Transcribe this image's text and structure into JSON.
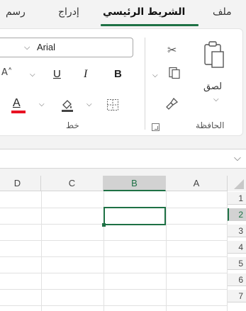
{
  "tabs": {
    "draw": "رسم",
    "insert": "إدراج",
    "home": "الشريط الرئيسي",
    "file": "ملف"
  },
  "ribbon": {
    "font_name": "Arial",
    "bold": "B",
    "italic": "I",
    "underline": "U",
    "font_color": "A",
    "font_group_label": "خط",
    "clipboard_group_label": "الحافظة",
    "paste_label": "لصق"
  },
  "grid": {
    "columns": [
      "A",
      "B",
      "C",
      "D"
    ],
    "rows": [
      "1",
      "2",
      "3",
      "4",
      "5",
      "6",
      "7"
    ],
    "selected_column": "B",
    "selected_row": "2"
  },
  "colors": {
    "accent": "#1e7145",
    "font_color_bar": "#e81123"
  },
  "icons": [
    "cut-icon",
    "copy-icon",
    "format-painter-icon",
    "paste-icon",
    "fill-color-icon",
    "borders-icon",
    "chevron-down-icon",
    "dialog-launcher-icon"
  ]
}
